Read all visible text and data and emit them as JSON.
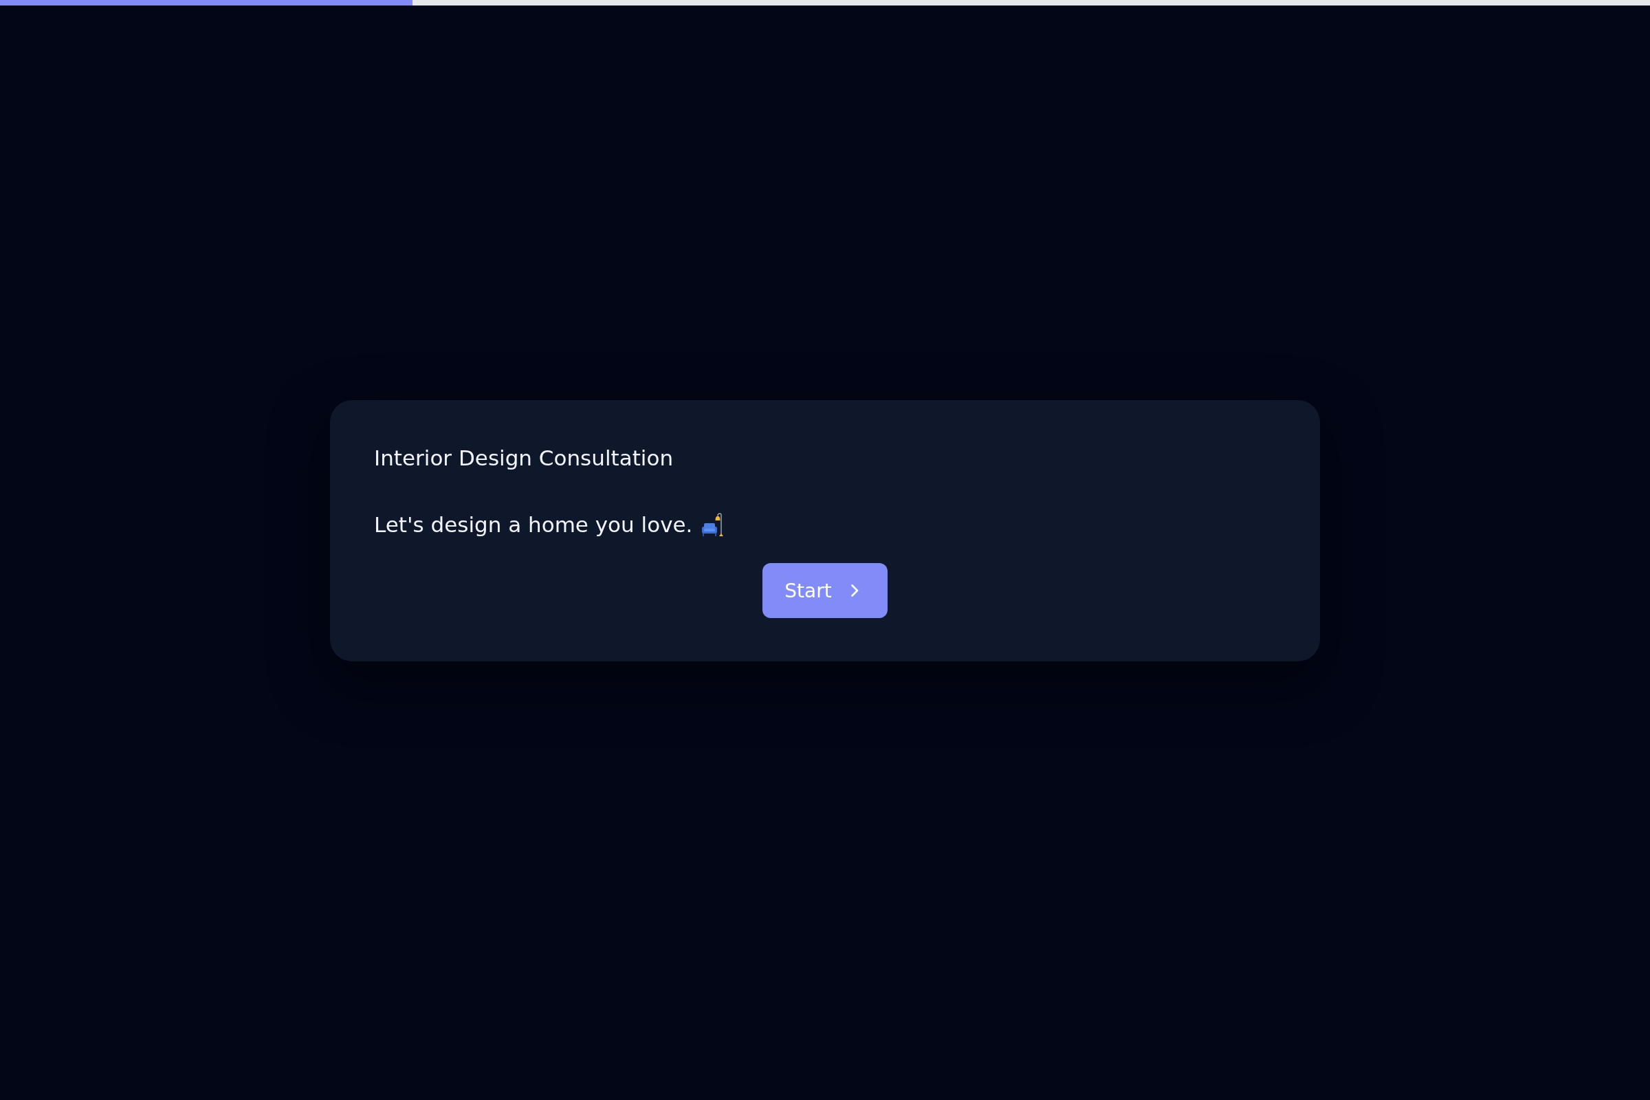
{
  "progress": {
    "level": 0.25
  },
  "card": {
    "title": "Interior Design Consultation",
    "message": "Let's design a home you love.",
    "button": {
      "label": "Start"
    }
  }
}
